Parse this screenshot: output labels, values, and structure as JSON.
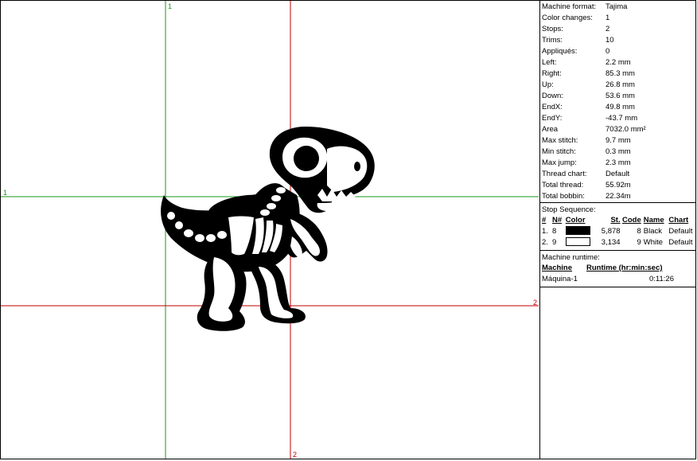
{
  "canvas": {
    "guide_labels": {
      "green_vertical": "1",
      "green_horizontal": "1",
      "red_vertical": "2",
      "red_horizontal": "2"
    },
    "guide_colors": {
      "first": "#1a9a1a",
      "second": "#c00000"
    },
    "design_colors": [
      "#000000",
      "#ffffff"
    ]
  },
  "stats": [
    {
      "label": "Machine format:",
      "value": "Tajima"
    },
    {
      "label": "Color changes:",
      "value": "1"
    },
    {
      "label": "Stops:",
      "value": "2"
    },
    {
      "label": "Trims:",
      "value": "10"
    },
    {
      "label": "Appliqués:",
      "value": "0"
    },
    {
      "label": "Left:",
      "value": "2.2 mm"
    },
    {
      "label": "Right:",
      "value": "85.3 mm"
    },
    {
      "label": "Up:",
      "value": "26.8 mm"
    },
    {
      "label": "Down:",
      "value": "53.6 mm"
    },
    {
      "label": "EndX:",
      "value": "49.8 mm"
    },
    {
      "label": "EndY:",
      "value": "-43.7 mm"
    },
    {
      "label": "Area",
      "value": "7032.0 mm²"
    },
    {
      "label": "Max stitch:",
      "value": "9.7 mm"
    },
    {
      "label": "Min stitch:",
      "value": "0.3 mm"
    },
    {
      "label": "Max jump:",
      "value": "2.3 mm"
    },
    {
      "label": "Thread chart:",
      "value": "Default"
    },
    {
      "label": "Total thread:",
      "value": "55.92m"
    },
    {
      "label": "Total bobbin:",
      "value": "22.34m"
    }
  ],
  "stop_sequence": {
    "title": "Stop Sequence:",
    "headers": {
      "num": "#",
      "n": "N#",
      "color": "Color",
      "st": "St.",
      "code": "Code",
      "name": "Name",
      "chart": "Chart"
    },
    "rows": [
      {
        "num": "1.",
        "n": "8",
        "swatch": "#000000",
        "st": "5,878",
        "code": "8",
        "name": "Black",
        "chart": "Default"
      },
      {
        "num": "2.",
        "n": "9",
        "swatch": "#ffffff",
        "st": "3,134",
        "code": "9",
        "name": "White",
        "chart": "Default"
      }
    ]
  },
  "runtime": {
    "title": "Machine runtime:",
    "headers": {
      "machine": "Machine",
      "runtime": "Runtime (hr:min:sec)"
    },
    "rows": [
      {
        "machine": "Máquina-1",
        "runtime": "0:11:26"
      }
    ]
  }
}
